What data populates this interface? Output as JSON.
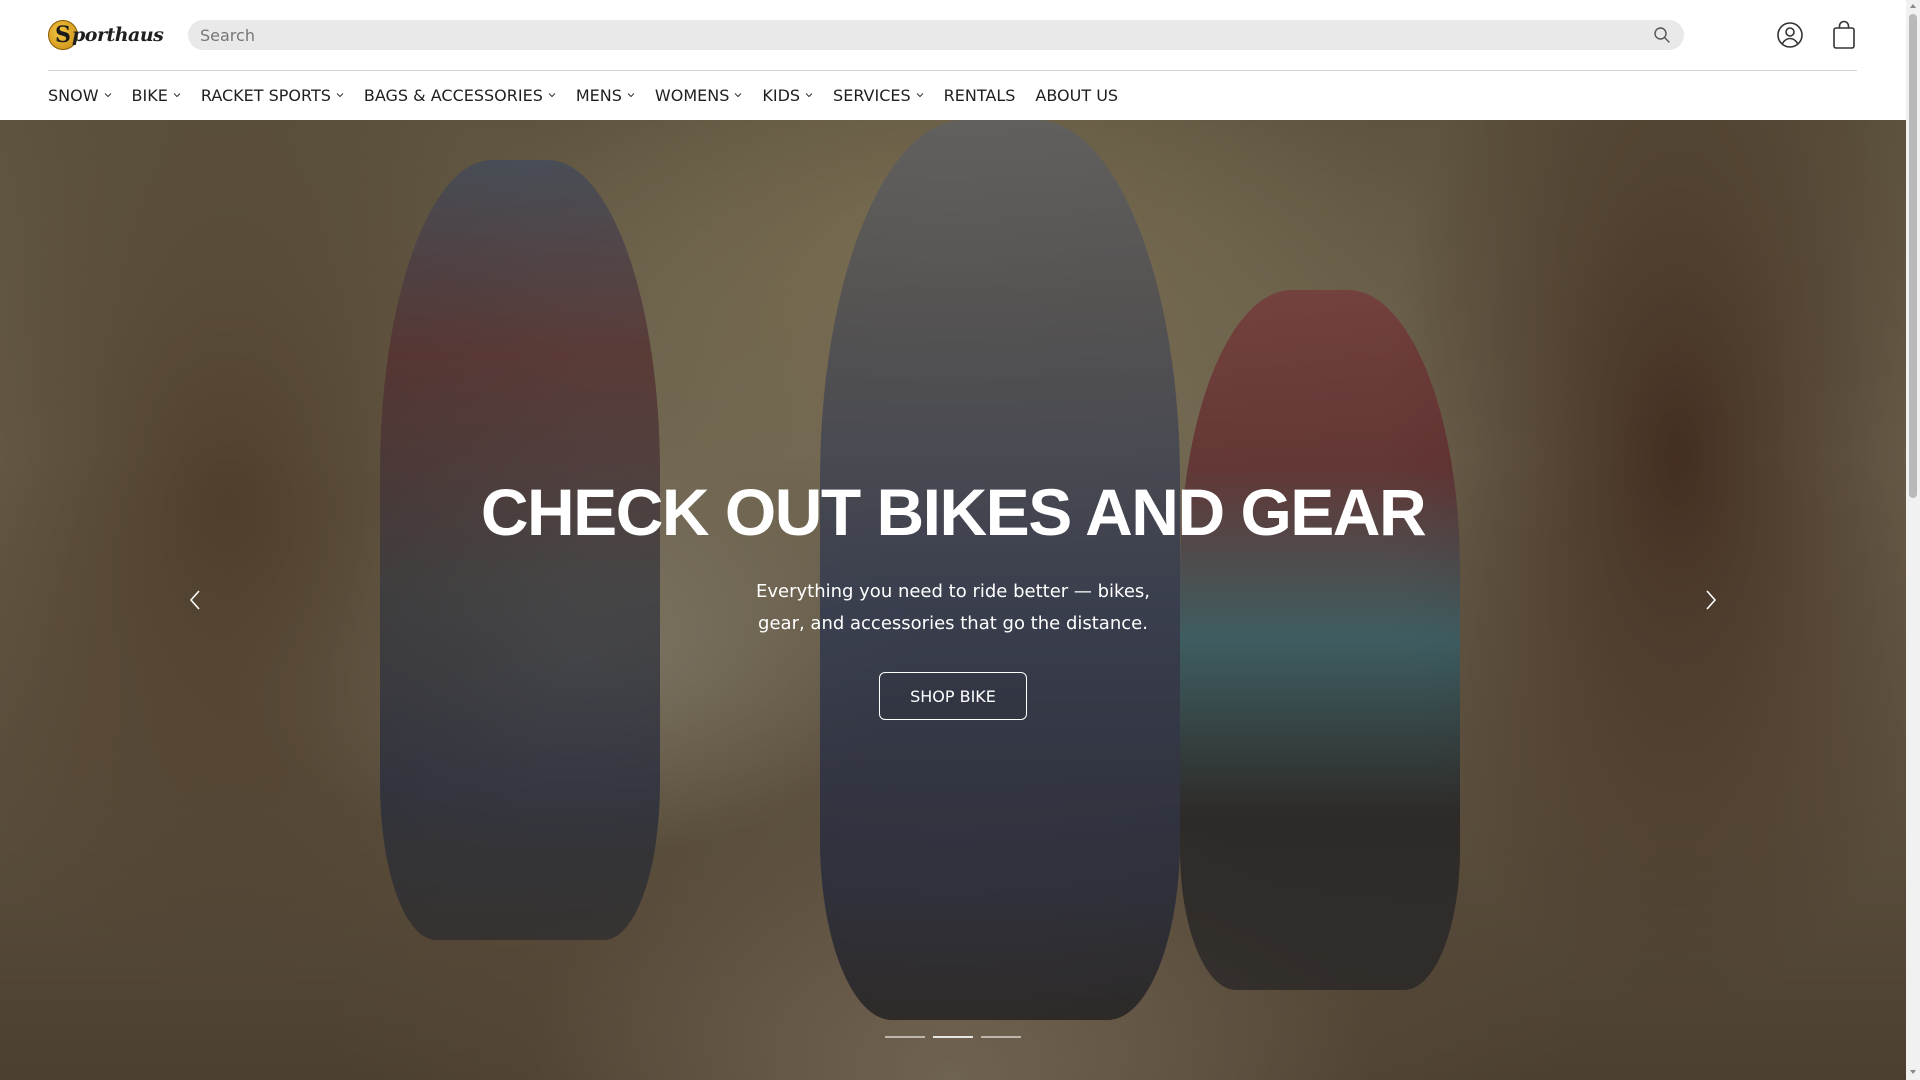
{
  "brand": {
    "name": "Sporthaus",
    "logo_letter": "S",
    "logo_rest": "porthaus"
  },
  "search": {
    "placeholder": "Search",
    "value": ""
  },
  "icons": {
    "search": "search-icon",
    "account": "account-icon",
    "cart": "cart-icon",
    "prev": "chevron-left-icon",
    "next": "chevron-right-icon"
  },
  "nav": {
    "items": [
      {
        "label": "SNOW",
        "dropdown": true
      },
      {
        "label": "BIKE",
        "dropdown": true
      },
      {
        "label": "RACKET SPORTS",
        "dropdown": true
      },
      {
        "label": "BAGS & ACCESSORIES",
        "dropdown": true
      },
      {
        "label": "MENS",
        "dropdown": true
      },
      {
        "label": "WOMENS",
        "dropdown": true
      },
      {
        "label": "KIDS",
        "dropdown": true
      },
      {
        "label": "SERVICES",
        "dropdown": true
      },
      {
        "label": "RENTALS",
        "dropdown": false
      },
      {
        "label": "ABOUT US",
        "dropdown": false
      }
    ]
  },
  "hero": {
    "title": "CHECK OUT BIKES AND GEAR",
    "subtitle": "Everything you need to ride better — bikes, gear, and accessories that go the distance.",
    "button_label": "SHOP BIKE",
    "slide_count": 3,
    "active_slide": 2
  },
  "colors": {
    "text": "#121212",
    "search_bg": "#e9e9ea",
    "hero_text": "#ffffff"
  }
}
